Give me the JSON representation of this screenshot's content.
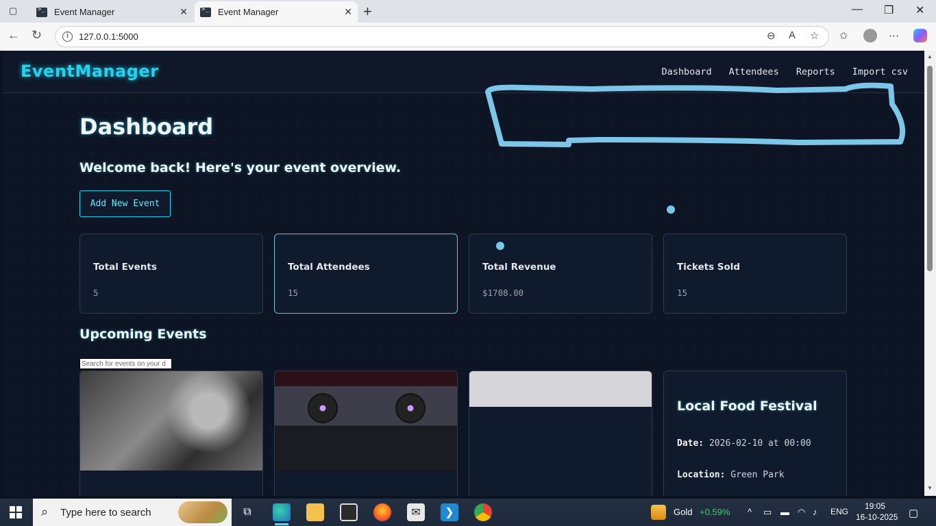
{
  "browser": {
    "tabs": [
      {
        "title": "Event Manager",
        "active": false
      },
      {
        "title": "Event Manager",
        "active": true
      }
    ],
    "url": "127.0.0.1:5000"
  },
  "app": {
    "brand": "EventManager",
    "nav": [
      "Dashboard",
      "Attendees",
      "Reports",
      "Import csv"
    ]
  },
  "dashboard": {
    "title": "Dashboard",
    "welcome": "Welcome back! Here's your event overview.",
    "add_button": "Add New Event",
    "stats": [
      {
        "label": "Total Events",
        "value": "5"
      },
      {
        "label": "Total Attendees",
        "value": "15"
      },
      {
        "label": "Total Revenue",
        "value": "$1708.00"
      },
      {
        "label": "Tickets Sold",
        "value": "15"
      }
    ],
    "upcoming_title": "Upcoming Events",
    "search_placeholder": "Search for events on your d",
    "food_event": {
      "title": "Local Food Festival",
      "date_label": "Date:",
      "date_value": "2026-02-10 at 00:00",
      "location_label": "Location:",
      "location_value": "Green Park"
    }
  },
  "taskbar": {
    "search_text": "Type here to search",
    "ticker_name": "Gold",
    "ticker_change": "+0.59%",
    "language": "ENG",
    "time": "19:05",
    "date": "16-10-2025"
  },
  "colors": {
    "accent": "#22d3ee",
    "annotation": "#7cc6ea",
    "ticker_up": "#3ccf6e"
  }
}
